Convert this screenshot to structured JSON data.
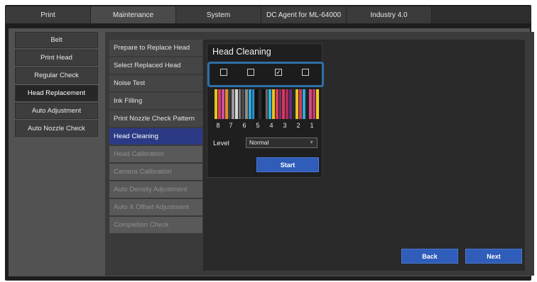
{
  "top_tabs": [
    {
      "label": "Print"
    },
    {
      "label": "Maintenance",
      "active": true
    },
    {
      "label": "System"
    },
    {
      "label": "DC Agent for ML-64000"
    },
    {
      "label": "Industry 4.0"
    }
  ],
  "left_menu": [
    {
      "label": "Belt"
    },
    {
      "label": "Print Head"
    },
    {
      "label": "Regular Check"
    },
    {
      "label": "Head Replacement",
      "active": true
    },
    {
      "label": "Auto Adjustment"
    },
    {
      "label": "Auto Nozzle Check"
    }
  ],
  "steps": [
    {
      "label": "Prepare to Replace Head",
      "state": "normal"
    },
    {
      "label": "Select Replaced Head",
      "state": "normal"
    },
    {
      "label": "Noise Test",
      "state": "normal"
    },
    {
      "label": "Ink Filling",
      "state": "normal"
    },
    {
      "label": "Print Nozzle Check Pattern",
      "state": "normal"
    },
    {
      "label": "Head Cleaning",
      "state": "active"
    },
    {
      "label": "Head Calibration",
      "state": "disabled"
    },
    {
      "label": "Camera Calibration",
      "state": "disabled"
    },
    {
      "label": "Auto Density Adjustment",
      "state": "disabled"
    },
    {
      "label": "Auto X Offset Adjustment",
      "state": "disabled"
    },
    {
      "label": "Completion Check",
      "state": "disabled"
    }
  ],
  "head_cleaning": {
    "title": "Head Cleaning",
    "checkboxes": [
      false,
      false,
      true,
      false
    ],
    "check_mark": "✓",
    "head_numbers": [
      "8",
      "7",
      "6",
      "5",
      "4",
      "3",
      "2",
      "1"
    ],
    "level_label": "Level",
    "level_value": "Normal",
    "start_label": "Start"
  },
  "nav": {
    "back_label": "Back",
    "next_label": "Next"
  },
  "colors": {
    "accent": "#2f5db9",
    "highlight_frame": "#2f6fa8",
    "active_step": "#2c3a86"
  }
}
